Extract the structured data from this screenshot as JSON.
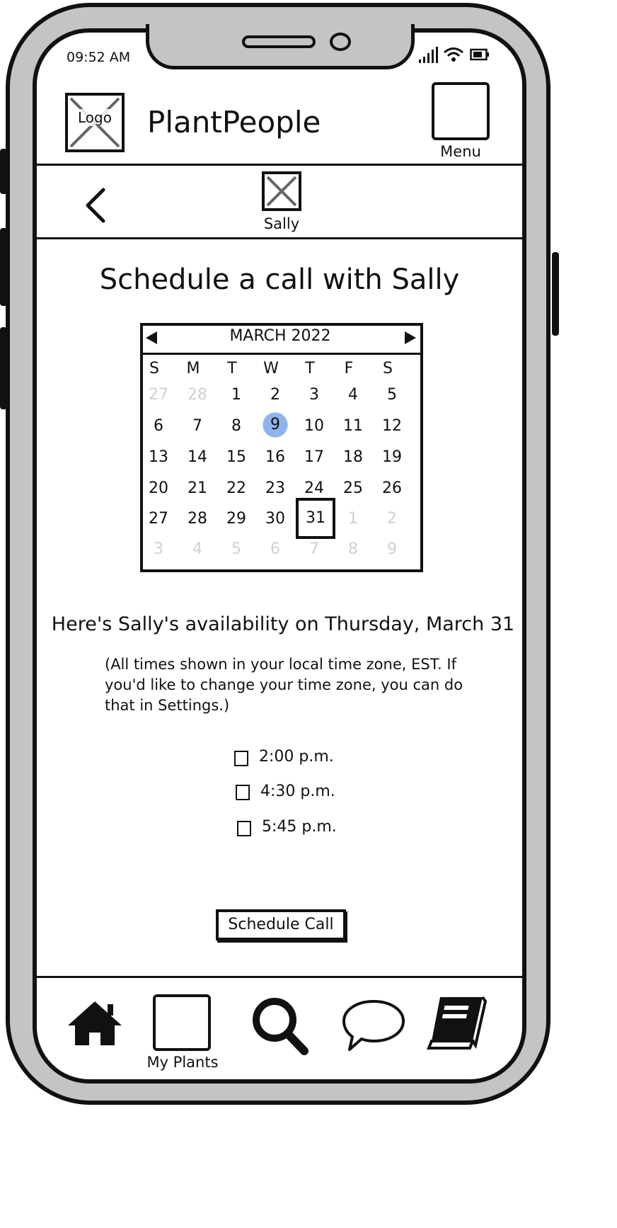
{
  "status_bar": {
    "time": "09:52 AM"
  },
  "header": {
    "logo_label": "Logo",
    "app_title": "PlantPeople",
    "menu_label": "Menu"
  },
  "profile": {
    "name": "Sally"
  },
  "main": {
    "heading": "Schedule a call with Sally",
    "availability_heading": "Here's Sally's availability on Thursday, March 31",
    "timezone_note": "(All times shown in your local time zone, EST. If you'd like to change your time zone, you can do that in Settings.)"
  },
  "calendar": {
    "title": "MARCH 2022",
    "weekdays": [
      "S",
      "M",
      "T",
      "W",
      "T",
      "F",
      "S"
    ],
    "weeks": [
      [
        "27",
        "28",
        "1",
        "2",
        "3",
        "4",
        "5"
      ],
      [
        "6",
        "7",
        "8",
        "9",
        "10",
        "11",
        "12"
      ],
      [
        "13",
        "14",
        "15",
        "16",
        "17",
        "18",
        "19"
      ],
      [
        "20",
        "21",
        "22",
        "23",
        "24",
        "25",
        "26"
      ],
      [
        "27",
        "28",
        "29",
        "30",
        "31",
        "1",
        "2"
      ],
      [
        "3",
        "4",
        "5",
        "6",
        "7",
        "8",
        "9"
      ]
    ],
    "today": "9",
    "selected": "31",
    "highlight_color": "#8fb4ea"
  },
  "time_slots": [
    "2:00 p.m.",
    "4:30 p.m.",
    "5:45 p.m."
  ],
  "schedule_button": "Schedule Call",
  "bottom_nav": {
    "my_plants_label": "My Plants"
  }
}
